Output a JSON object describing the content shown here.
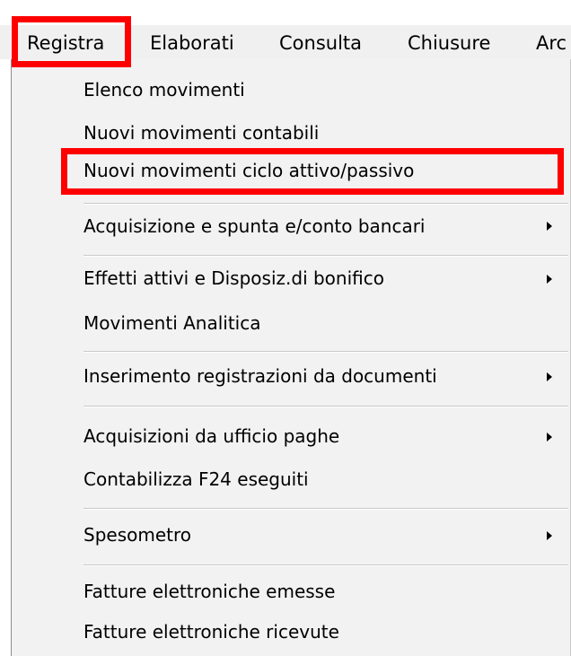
{
  "menubar": {
    "items": [
      {
        "label": "Registra"
      },
      {
        "label": "Elaborati"
      },
      {
        "label": "Consulta"
      },
      {
        "label": "Chiusure"
      },
      {
        "label": "Arc"
      }
    ]
  },
  "dropdown": {
    "items": [
      {
        "label": "Elenco movimenti",
        "has_submenu": false
      },
      {
        "label": "Nuovi movimenti contabili",
        "has_submenu": false
      },
      {
        "label": "Nuovi movimenti ciclo attivo/passivo",
        "has_submenu": false
      },
      {
        "label": "Acquisizione e spunta e/conto bancari",
        "has_submenu": true
      },
      {
        "label": "Effetti attivi e Disposiz.di bonifico",
        "has_submenu": true
      },
      {
        "label": "Movimenti Analitica",
        "has_submenu": false
      },
      {
        "label": "Inserimento registrazioni da documenti",
        "has_submenu": true
      },
      {
        "label": "Acquisizioni da ufficio paghe",
        "has_submenu": true
      },
      {
        "label": "Contabilizza F24 eseguiti",
        "has_submenu": false
      },
      {
        "label": "Spesometro",
        "has_submenu": true
      },
      {
        "label": "Fatture elettroniche emesse",
        "has_submenu": false
      },
      {
        "label": "Fatture elettroniche ricevute",
        "has_submenu": false
      }
    ]
  },
  "annotations": {
    "highlight_color": "#ff0000",
    "highlighted_items": [
      "Registra",
      "Nuovi movimenti ciclo attivo/passivo"
    ]
  }
}
